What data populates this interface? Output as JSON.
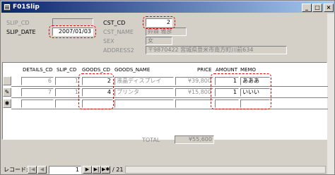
{
  "window": {
    "title": "F01Slip",
    "min": "_",
    "max": "□",
    "close": "×"
  },
  "header": {
    "slip_cd_label": "SLIP_CD",
    "slip_cd_value": "",
    "slip_date_label": "SLIP_DATE",
    "slip_date_value": "2007/01/03",
    "cst_cd_label": "CST_CD",
    "cst_cd_value": "2",
    "cst_name_label": "CST_NAME",
    "cst_name_value": "鈴森  雅彦",
    "sex_label": "SEX",
    "sex_value": "女",
    "address2_label": "ADDRESS2",
    "address2_value": "〒9870422 宮城県登米市南方町川前634"
  },
  "grid": {
    "columns": [
      "DETAILS_CD",
      "SLIP_CD",
      "GOODS_CD",
      "GOODS_NAME",
      "PRICE",
      "AMOUNT",
      "MEMO"
    ],
    "rows": [
      {
        "selector": "",
        "details_cd": "6",
        "slip_cd": "1",
        "goods_cd": "2",
        "goods_name": "液晶ディスプレイ",
        "price": "¥39,800",
        "amount": "1",
        "memo": "あああ"
      },
      {
        "selector": "✎",
        "details_cd": "7",
        "slip_cd": "1",
        "goods_cd": "4",
        "goods_name": "プリンタ",
        "price": "¥15,800",
        "amount": "1",
        "memo": "いいい"
      },
      {
        "selector": "✱",
        "details_cd": "",
        "slip_cd": "",
        "goods_cd": "",
        "goods_name": "",
        "price": "",
        "amount": "",
        "memo": ""
      }
    ]
  },
  "total": {
    "label": "TOTAL",
    "value": "¥55,600"
  },
  "nav": {
    "label": "レコード:",
    "current": "1",
    "of_total": "/ 21"
  },
  "colors": {
    "highlight": "#e00000",
    "titlebar": "#0a246a"
  }
}
